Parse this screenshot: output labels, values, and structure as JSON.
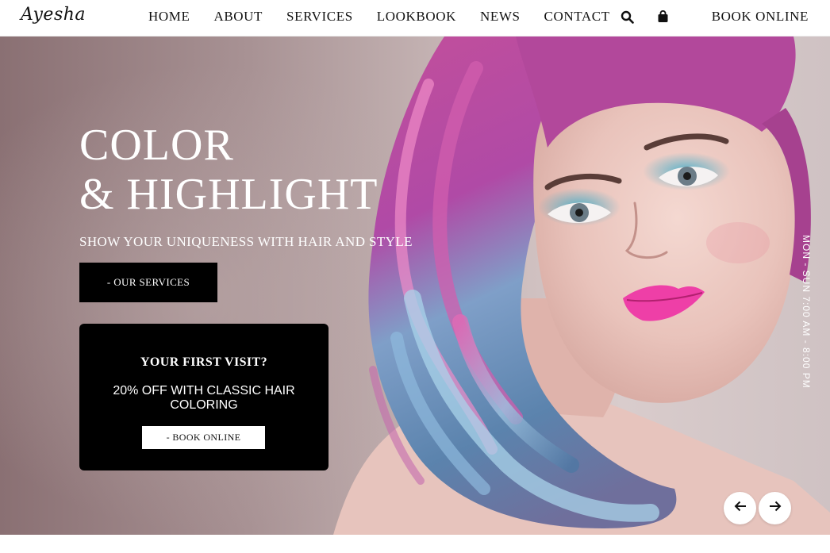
{
  "brand": {
    "logo_text": "Ayesha"
  },
  "nav": {
    "links": [
      {
        "label": "HOME"
      },
      {
        "label": "ABOUT"
      },
      {
        "label": "SERVICES"
      },
      {
        "label": "LOOKBOOK"
      },
      {
        "label": "NEWS"
      },
      {
        "label": "CONTACT"
      }
    ],
    "icons": [
      "search-icon",
      "shopping-bag-icon"
    ],
    "book_online_label": "BOOK ONLINE"
  },
  "hero": {
    "title_line1": "COLOR",
    "title_line2": "& HIGHLIGHT",
    "subtitle": "SHOW YOUR UNIQUENESS WITH HAIR AND STYLE",
    "services_button_label": "- OUR SERVICES",
    "hours": "MON - SUN 7:00 AM - 8:00 PM",
    "slider_icons": [
      "arrow-left-icon",
      "arrow-right-icon"
    ]
  },
  "promo": {
    "heading": "YOUR FIRST VISIT?",
    "text": "20% OFF WITH CLASSIC HAIR COLORING",
    "button_label": "- BOOK ONLINE"
  },
  "colors": {
    "nav_background": "#ffffff",
    "button_background": "#000000",
    "hero_text": "#ffffff",
    "hair_pink": "#c64f9a",
    "hair_blue": "#6fa3c7",
    "lip_pink": "#ee3fa7"
  }
}
